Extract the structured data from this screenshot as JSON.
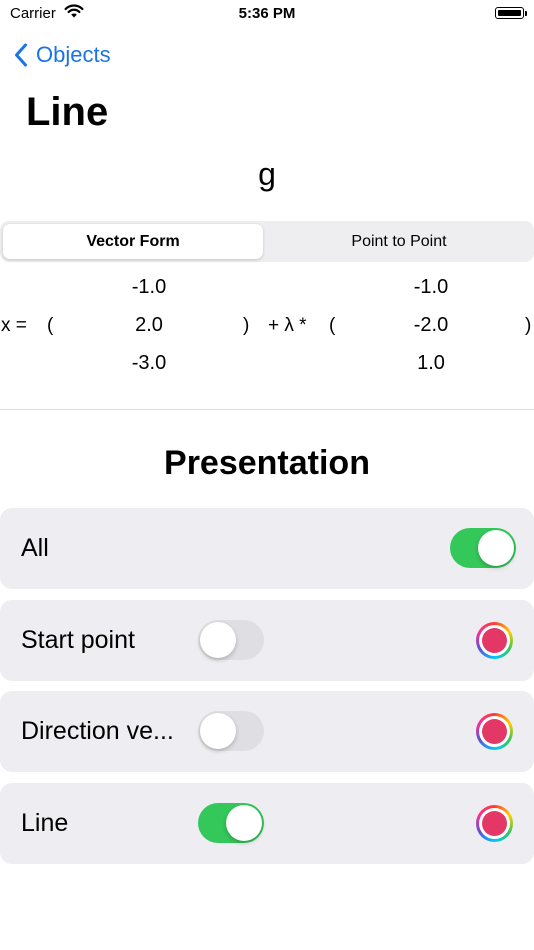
{
  "status_bar": {
    "carrier": "Carrier",
    "time": "5:36 PM"
  },
  "nav": {
    "back_label": "Objects",
    "title": "Line"
  },
  "object_name": "g",
  "segments": [
    {
      "label": "Vector Form",
      "selected": true
    },
    {
      "label": "Point to Point",
      "selected": false
    }
  ],
  "equation": {
    "lhs": "x =",
    "open_paren": "(",
    "close_paren": ")",
    "plus_lambda": "+ λ *",
    "point": [
      "-1.0",
      "2.0",
      "-3.0"
    ],
    "direction": [
      "-1.0",
      "-2.0",
      "1.0"
    ]
  },
  "presentation": {
    "title": "Presentation",
    "rows": [
      {
        "label": "All",
        "toggle_on": true
      },
      {
        "label": "Start point",
        "toggle_on": false,
        "color": "#e33866"
      },
      {
        "label": "Direction ve...",
        "toggle_on": false,
        "color": "#e33866"
      },
      {
        "label": "Line",
        "toggle_on": true,
        "color": "#e33866"
      }
    ]
  },
  "colors": {
    "accent": "#1a74e8",
    "toggle_on": "#34c759",
    "swatch": "#e33866"
  }
}
